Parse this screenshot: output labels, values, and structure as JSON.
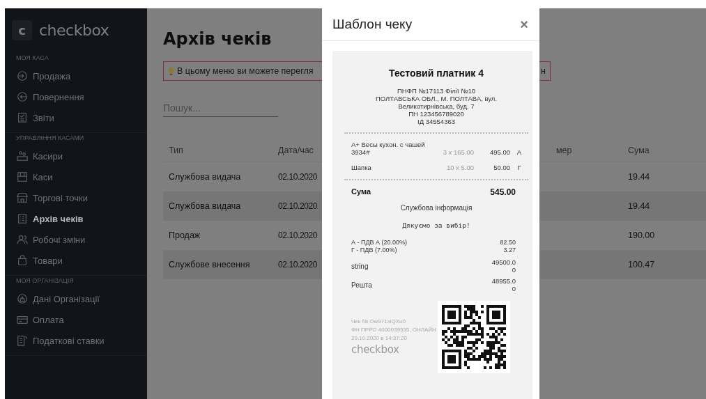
{
  "sidebar": {
    "logo": {
      "mark": "c",
      "name": "checkbox"
    },
    "sections": [
      {
        "title": "МОЯ КАСА",
        "items": [
          {
            "label": "Продажа",
            "selected": false
          },
          {
            "label": "Повернення",
            "selected": false
          },
          {
            "label": "Звіти",
            "selected": false
          }
        ]
      },
      {
        "title": "УПРАВЛІННЯ КАСАМИ",
        "items": [
          {
            "label": "Касири",
            "selected": false
          },
          {
            "label": "Каси",
            "selected": false
          },
          {
            "label": "Торгові точки",
            "selected": false
          },
          {
            "label": "Архів чеків",
            "selected": true
          },
          {
            "label": "Робочі зміни",
            "selected": false
          },
          {
            "label": "Товари",
            "selected": false
          }
        ]
      },
      {
        "title": "МОЯ ОРГАНІЗАЦІЯ",
        "items": [
          {
            "label": "Дані Організації",
            "selected": false
          },
          {
            "label": "Оплата",
            "selected": false
          },
          {
            "label": "Податкові ставки",
            "selected": false
          }
        ]
      }
    ]
  },
  "page": {
    "title": "Архів чеків",
    "hint": {
      "text_left": "В цьому меню ви можете перегля",
      "text_right": "н"
    },
    "search": {
      "placeholder": "Пошук..."
    }
  },
  "table": {
    "columns": [
      "Тип",
      "Дата/час",
      "мер",
      "Сума"
    ],
    "rows": [
      {
        "type": "Службова видача",
        "date": "02.10.2020",
        "sum": "19.44"
      },
      {
        "type": "Службова видача",
        "date": "02.10.2020",
        "sum": "19.44"
      },
      {
        "type": "Продаж",
        "date": "02.10.2020",
        "sum": "190.00"
      },
      {
        "type": "Службове внесення",
        "date": "02.10.2020",
        "sum": "100.47"
      }
    ]
  },
  "modal": {
    "title": "Шаблон чеку",
    "close": "×",
    "receipt": {
      "title": "Тестовий платник 4",
      "header_lines": [
        "ПНФП №17113 Філії №10",
        "ПОЛТАВСЬКА ОБЛ., М. ПОЛТАВА, вул. Великотирнівська, буд. 7",
        "ПН 123456789020",
        "ІД 34554363"
      ],
      "items": [
        {
          "name": "А+ Весы кухон. с чашей 3934#",
          "qty": "3 x 165.00",
          "amount": "495.00",
          "tax": "А"
        },
        {
          "name": "Шапка",
          "qty": "10 x 5.00",
          "amount": "50.00",
          "tax": "Г"
        }
      ],
      "total": {
        "label": "Сума",
        "value": "545.00"
      },
      "service_info": "Службова інформація",
      "thanks": "Дякуємо за вибір!",
      "taxes": [
        {
          "label": "А - ПДВ А (20.00%)",
          "value": "82.50"
        },
        {
          "label": "Г - ПДВ (7.00%)",
          "value": "3.27"
        }
      ],
      "payments": [
        {
          "label": "string",
          "value": "49500.00"
        },
        {
          "label": "Решта",
          "value": "48955.00"
        }
      ],
      "footer_lines": [
        "Чек № Ow971xiQXu0",
        "ФН ПРРО 4000039535, ОНЛАЙН",
        "29.10.2020 в 14:37:20"
      ],
      "brand": "checkbox"
    }
  }
}
